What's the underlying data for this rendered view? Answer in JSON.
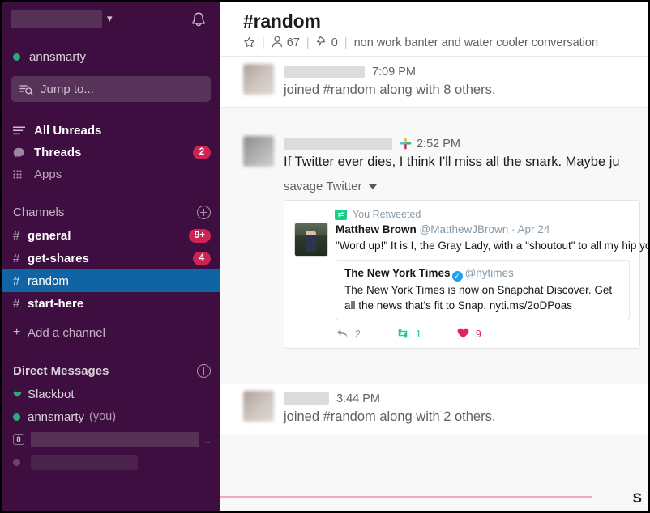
{
  "workspace": {
    "name_redacted": true,
    "caret_icon": "chevron-down-icon",
    "notifications_icon": "bell-icon",
    "user": "annsmarty",
    "presence": "active"
  },
  "search": {
    "placeholder": "Jump to...",
    "icon": "search-jump-icon"
  },
  "sidebar": {
    "nav": [
      {
        "label": "All Unreads",
        "icon": "unreads-icon",
        "badge": "",
        "style": "bold"
      },
      {
        "label": "Threads",
        "icon": "threads-icon",
        "badge": "2",
        "style": "bold"
      },
      {
        "label": "Apps",
        "icon": "apps-grid-icon",
        "badge": "",
        "style": "dim"
      }
    ],
    "channels_section": {
      "label": "Channels",
      "add_icon": "plus-circle-icon"
    },
    "channels": [
      {
        "name": "general",
        "badge": "9+",
        "state": "unread"
      },
      {
        "name": "get-shares",
        "badge": "4",
        "state": "unread"
      },
      {
        "name": "random",
        "badge": "",
        "state": "active"
      },
      {
        "name": "start-here",
        "badge": "",
        "state": "unread"
      }
    ],
    "add_channel_label": "Add a channel",
    "dm_section": {
      "label": "Direct Messages",
      "add_icon": "plus-circle-icon"
    },
    "dms": [
      {
        "name": "Slackbot",
        "icon": "heart-icon",
        "suffix": "",
        "redacted": false
      },
      {
        "name": "annsmarty",
        "icon": "presence-dot-icon",
        "suffix": "(you)",
        "redacted": false
      },
      {
        "name": "",
        "icon": "member-count-badge-8",
        "badge": "8",
        "suffix": "..",
        "redacted": true
      }
    ]
  },
  "channel": {
    "title": "#random",
    "star_icon": "star-icon",
    "members_icon": "members-icon",
    "members_count": "67",
    "pins_icon": "pin-icon",
    "pins_count": "0",
    "topic": "non work banter and water cooler conversation"
  },
  "messages": [
    {
      "id": "msg-1",
      "author_redacted": true,
      "timestamp": "7:09 PM",
      "text": "joined #random along with 8 others.",
      "type": "system",
      "app_icon": ""
    },
    {
      "id": "msg-2",
      "author_redacted": true,
      "timestamp": "2:52 PM",
      "app_icon": "slack-logo-icon",
      "text": "If Twitter ever dies, I think I'll miss all the snark. Maybe ju",
      "type": "user",
      "attachment_title": "savage Twitter",
      "attachment_caret": "caret-down-icon",
      "tweet": {
        "retweet_label": "You Retweeted",
        "retweet_icon": "retweet-icon",
        "author_name": "Matthew Brown",
        "author_handle": "@MatthewJBrown",
        "date_separator": "·",
        "date": "Apr 24",
        "text": "\"Word up!\" It is I, the Gray Lady, with a \"shoutout\" to all my hip young friends.",
        "quoted": {
          "name": "The New York Times",
          "verified": true,
          "handle": "@nytimes",
          "text": "The New York Times is now on Snapchat Discover. Get all the news that's fit to Snap. nyti.ms/2oDPoas"
        },
        "stats": {
          "replies": "2",
          "retweets": "1",
          "likes": "9",
          "reply_icon": "reply-arrow-icon",
          "retweet_icon": "retweet-icon",
          "like_icon": "heart-icon"
        }
      }
    },
    {
      "id": "msg-3",
      "author_redacted": true,
      "timestamp": "3:44 PM",
      "text": "joined #random along with 2 others.",
      "type": "system",
      "app_icon": ""
    }
  ],
  "footer": {
    "cut_label": "S"
  },
  "colors": {
    "sidebar_bg": "#3F0E40",
    "active_channel": "#1164A3",
    "badge": "#CD2553",
    "presence_green": "#2BAC76",
    "twitter_blue": "#1DA1F2",
    "retweet_green": "#19CF86",
    "like_red": "#E0245E",
    "pink_rule": "#F4A6C0"
  }
}
